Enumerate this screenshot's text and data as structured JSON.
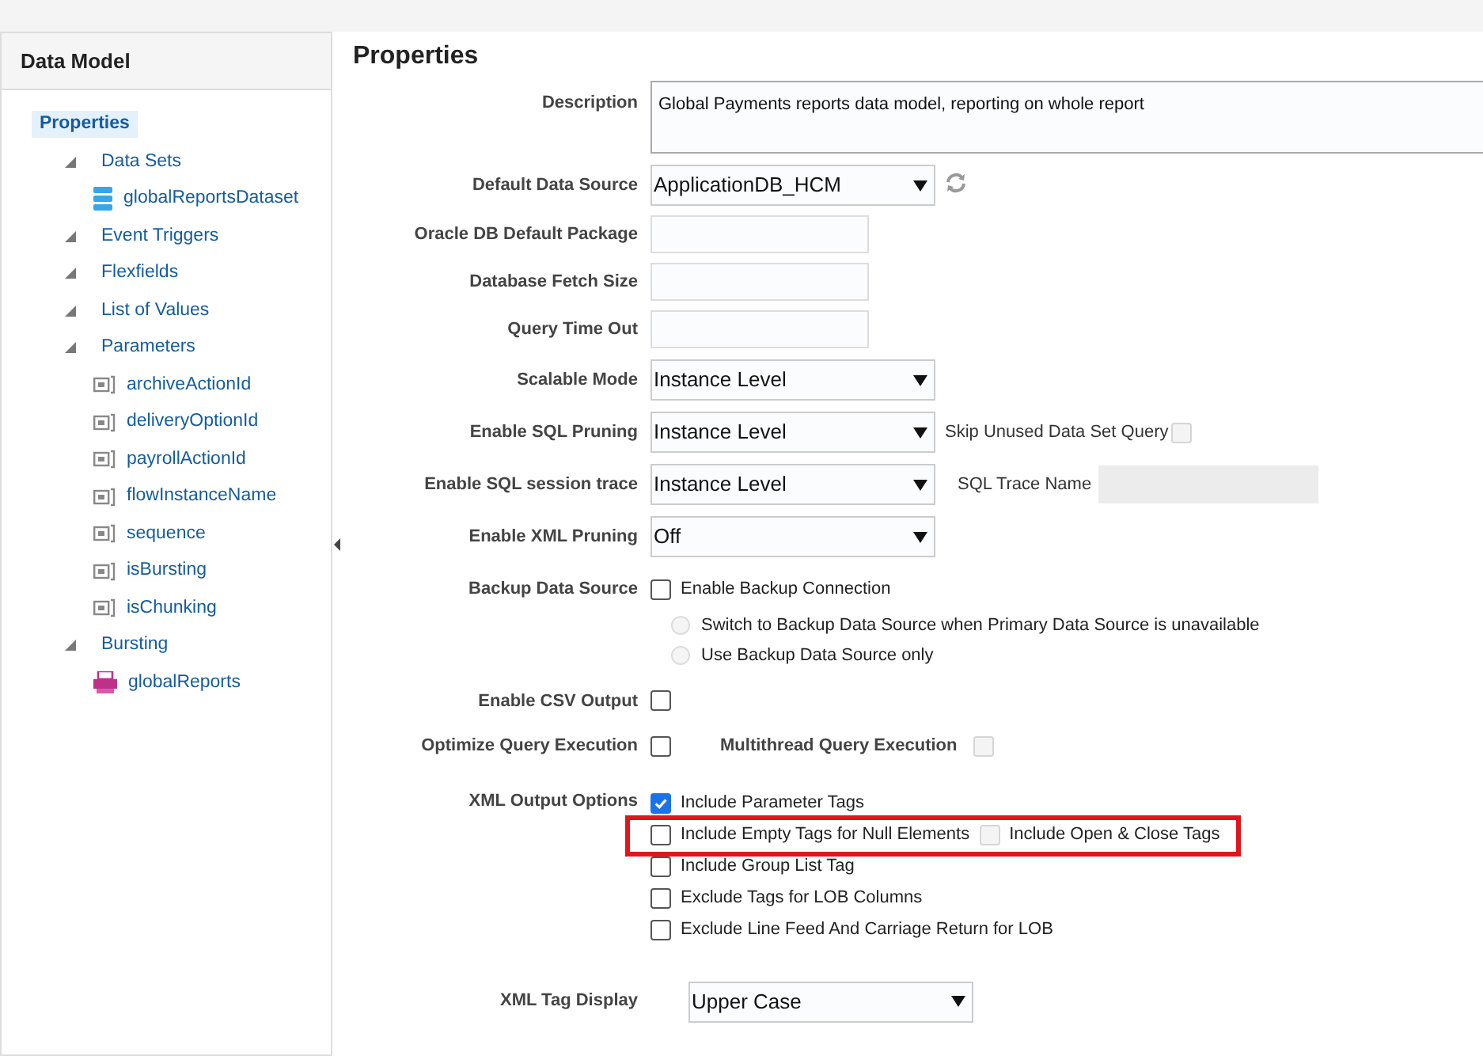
{
  "sidebar": {
    "title": "Data Model",
    "tree": [
      {
        "label": "Properties",
        "selected": true,
        "children": [
          {
            "label": "Data Sets",
            "selected": false,
            "expanded": true,
            "children": [
              {
                "label": "globalReportsDataset",
                "kind": "dataset",
                "selected": false
              }
            ]
          },
          {
            "label": "Event Triggers",
            "selected": false,
            "expanded": true
          },
          {
            "label": "Flexfields",
            "selected": false,
            "expanded": true
          },
          {
            "label": "List of Values",
            "selected": false,
            "expanded": true
          },
          {
            "label": "Parameters",
            "selected": false,
            "expanded": true,
            "children": [
              {
                "label": "archiveActionId",
                "kind": "parameter",
                "selected": false
              },
              {
                "label": "deliveryOptionId",
                "kind": "parameter",
                "selected": false
              },
              {
                "label": "payrollActionId",
                "kind": "parameter",
                "selected": false
              },
              {
                "label": "flowInstanceName",
                "kind": "parameter",
                "selected": false
              },
              {
                "label": "sequence",
                "kind": "parameter",
                "selected": false
              },
              {
                "label": "isBursting",
                "kind": "parameter",
                "selected": false
              },
              {
                "label": "isChunking",
                "kind": "parameter",
                "selected": false
              }
            ]
          },
          {
            "label": "Bursting",
            "selected": false,
            "expanded": true,
            "children": [
              {
                "label": "globalReports",
                "kind": "bursting",
                "selected": false
              }
            ]
          }
        ]
      }
    ]
  },
  "form": {
    "title": "Properties",
    "rows": [
      {
        "kind": "textarea",
        "label": "Description",
        "value": "Global Payments reports data model, reporting on whole report"
      },
      {
        "kind": "select",
        "label": "Default Data Source",
        "value": "ApplicationDB_HCM",
        "extra": {
          "kind": "refresh"
        }
      },
      {
        "kind": "input",
        "label": "Oracle DB Default Package"
      },
      {
        "kind": "input",
        "label": "Database Fetch Size"
      },
      {
        "kind": "input",
        "label": "Query Time Out"
      },
      {
        "kind": "select",
        "label": "Scalable Mode",
        "value": "Instance Level"
      },
      {
        "kind": "select",
        "label": "Enable SQL Pruning",
        "value": "Instance Level",
        "extra": {
          "kind": "checkbox",
          "label": "Skip Unused Data Set Query",
          "checked": false,
          "disabled": true
        }
      },
      {
        "kind": "select",
        "label": "Enable SQL session trace",
        "value": "Instance Level",
        "extra": {
          "kind": "input",
          "label": "SQL Trace Name",
          "disabled": true
        }
      },
      {
        "kind": "select",
        "label": "Enable XML Pruning",
        "value": "Off"
      },
      {
        "kind": "backup",
        "label": "Backup Data Source",
        "checkbox": {
          "label": "Enable Backup Connection",
          "checked": false
        },
        "radios": [
          {
            "label": "Switch to Backup Data Source when Primary Data Source is unavailable",
            "selected": false,
            "disabled": true
          },
          {
            "label": "Use Backup Data Source only",
            "selected": false,
            "disabled": true
          }
        ]
      },
      {
        "kind": "checkbox",
        "label": "Enable CSV Output",
        "checked": false
      },
      {
        "kind": "checkbox",
        "label": "Optimize Query Execution",
        "checked": false,
        "extra": {
          "label": "Multithread Query Execution",
          "checked": false,
          "disabled": true
        }
      },
      {
        "kind": "options",
        "label": "XML Output Options",
        "options": [
          {
            "label": "Include Parameter Tags",
            "checked": true,
            "highlighted": false
          },
          {
            "label": "Include Empty Tags for Null Elements",
            "checked": false,
            "highlighted": true,
            "extra": {
              "label": "Include Open & Close Tags",
              "checked": false,
              "disabled": true
            }
          },
          {
            "label": "Include Group List Tag",
            "checked": false,
            "highlighted": false
          },
          {
            "label": "Exclude Tags for LOB Columns",
            "checked": false,
            "highlighted": false
          },
          {
            "label": "Exclude Line Feed And Carriage Return for LOB",
            "checked": false,
            "highlighted": false
          }
        ]
      }
    ],
    "xml_tag_display": {
      "label": "XML Tag Display",
      "value": "Upper Case"
    }
  }
}
